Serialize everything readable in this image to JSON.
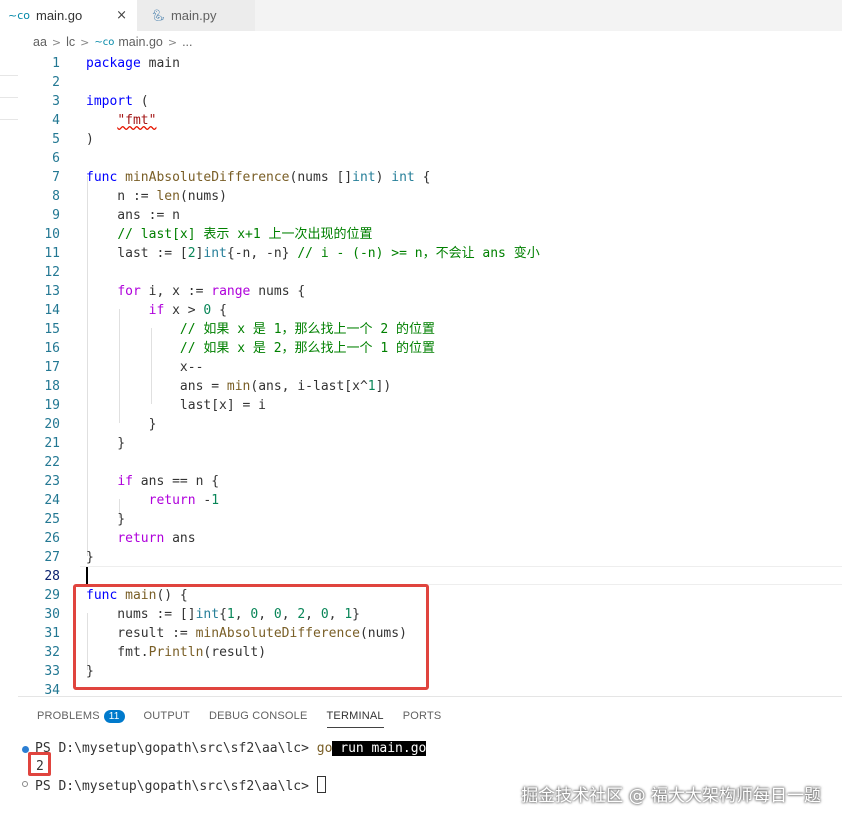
{
  "tabs": [
    {
      "icon": "go-icon",
      "label": "main.go",
      "active": true,
      "close": "×"
    },
    {
      "icon": "python-icon",
      "label": "main.py",
      "active": false
    }
  ],
  "breadcrumb": [
    "aa",
    "lc",
    "main.go",
    "..."
  ],
  "editor": {
    "active_line": 28,
    "lines": [
      {
        "n": 1,
        "text": "package main"
      },
      {
        "n": 2,
        "text": ""
      },
      {
        "n": 3,
        "text": "import ("
      },
      {
        "n": 4,
        "text": "    \"fmt\""
      },
      {
        "n": 5,
        "text": ")"
      },
      {
        "n": 6,
        "text": ""
      },
      {
        "n": 7,
        "text": "func minAbsoluteDifference(nums []int) int {"
      },
      {
        "n": 8,
        "text": "    n := len(nums)"
      },
      {
        "n": 9,
        "text": "    ans := n"
      },
      {
        "n": 10,
        "text": "    // last[x] 表示 x+1 上一次出现的位置"
      },
      {
        "n": 11,
        "text": "    last := [2]int{-n, -n} // i - (-n) >= n，不会让 ans 变小"
      },
      {
        "n": 12,
        "text": ""
      },
      {
        "n": 13,
        "text": "    for i, x := range nums {"
      },
      {
        "n": 14,
        "text": "        if x > 0 {"
      },
      {
        "n": 15,
        "text": "            // 如果 x 是 1，那么找上一个 2 的位置"
      },
      {
        "n": 16,
        "text": "            // 如果 x 是 2，那么找上一个 1 的位置"
      },
      {
        "n": 17,
        "text": "            x--"
      },
      {
        "n": 18,
        "text": "            ans = min(ans, i-last[x^1])"
      },
      {
        "n": 19,
        "text": "            last[x] = i"
      },
      {
        "n": 20,
        "text": "        }"
      },
      {
        "n": 21,
        "text": "    }"
      },
      {
        "n": 22,
        "text": ""
      },
      {
        "n": 23,
        "text": "    if ans == n {"
      },
      {
        "n": 24,
        "text": "        return -1"
      },
      {
        "n": 25,
        "text": "    }"
      },
      {
        "n": 26,
        "text": "    return ans"
      },
      {
        "n": 27,
        "text": "}"
      },
      {
        "n": 28,
        "text": ""
      },
      {
        "n": 29,
        "text": "func main() {"
      },
      {
        "n": 30,
        "text": "    nums := []int{1, 0, 0, 2, 0, 1}"
      },
      {
        "n": 31,
        "text": "    result := minAbsoluteDifference(nums)"
      },
      {
        "n": 32,
        "text": "    fmt.Println(result)"
      },
      {
        "n": 33,
        "text": "}"
      },
      {
        "n": 34,
        "text": ""
      }
    ]
  },
  "panel": {
    "tabs": [
      {
        "label": "PROBLEMS",
        "badge": "11"
      },
      {
        "label": "OUTPUT"
      },
      {
        "label": "DEBUG CONSOLE"
      },
      {
        "label": "TERMINAL",
        "active": true
      },
      {
        "label": "PORTS"
      }
    ],
    "terminal": {
      "prompt1": "PS D:\\mysetup\\gopath\\src\\sf2\\aa\\lc> ",
      "cmd_go": "go",
      "cmd_rest": " run main.go",
      "output": "2",
      "prompt2": "PS D:\\mysetup\\gopath\\src\\sf2\\aa\\lc> "
    }
  },
  "watermark": "掘金技术社区 @ 福大大架构师每日一题",
  "colors": {
    "keyword": "#0000ff",
    "control": "#af00db",
    "string": "#a31515",
    "number": "#098658",
    "comment": "#008000",
    "function": "#795e26",
    "type": "#267f99",
    "highlight": "#e0443e"
  }
}
